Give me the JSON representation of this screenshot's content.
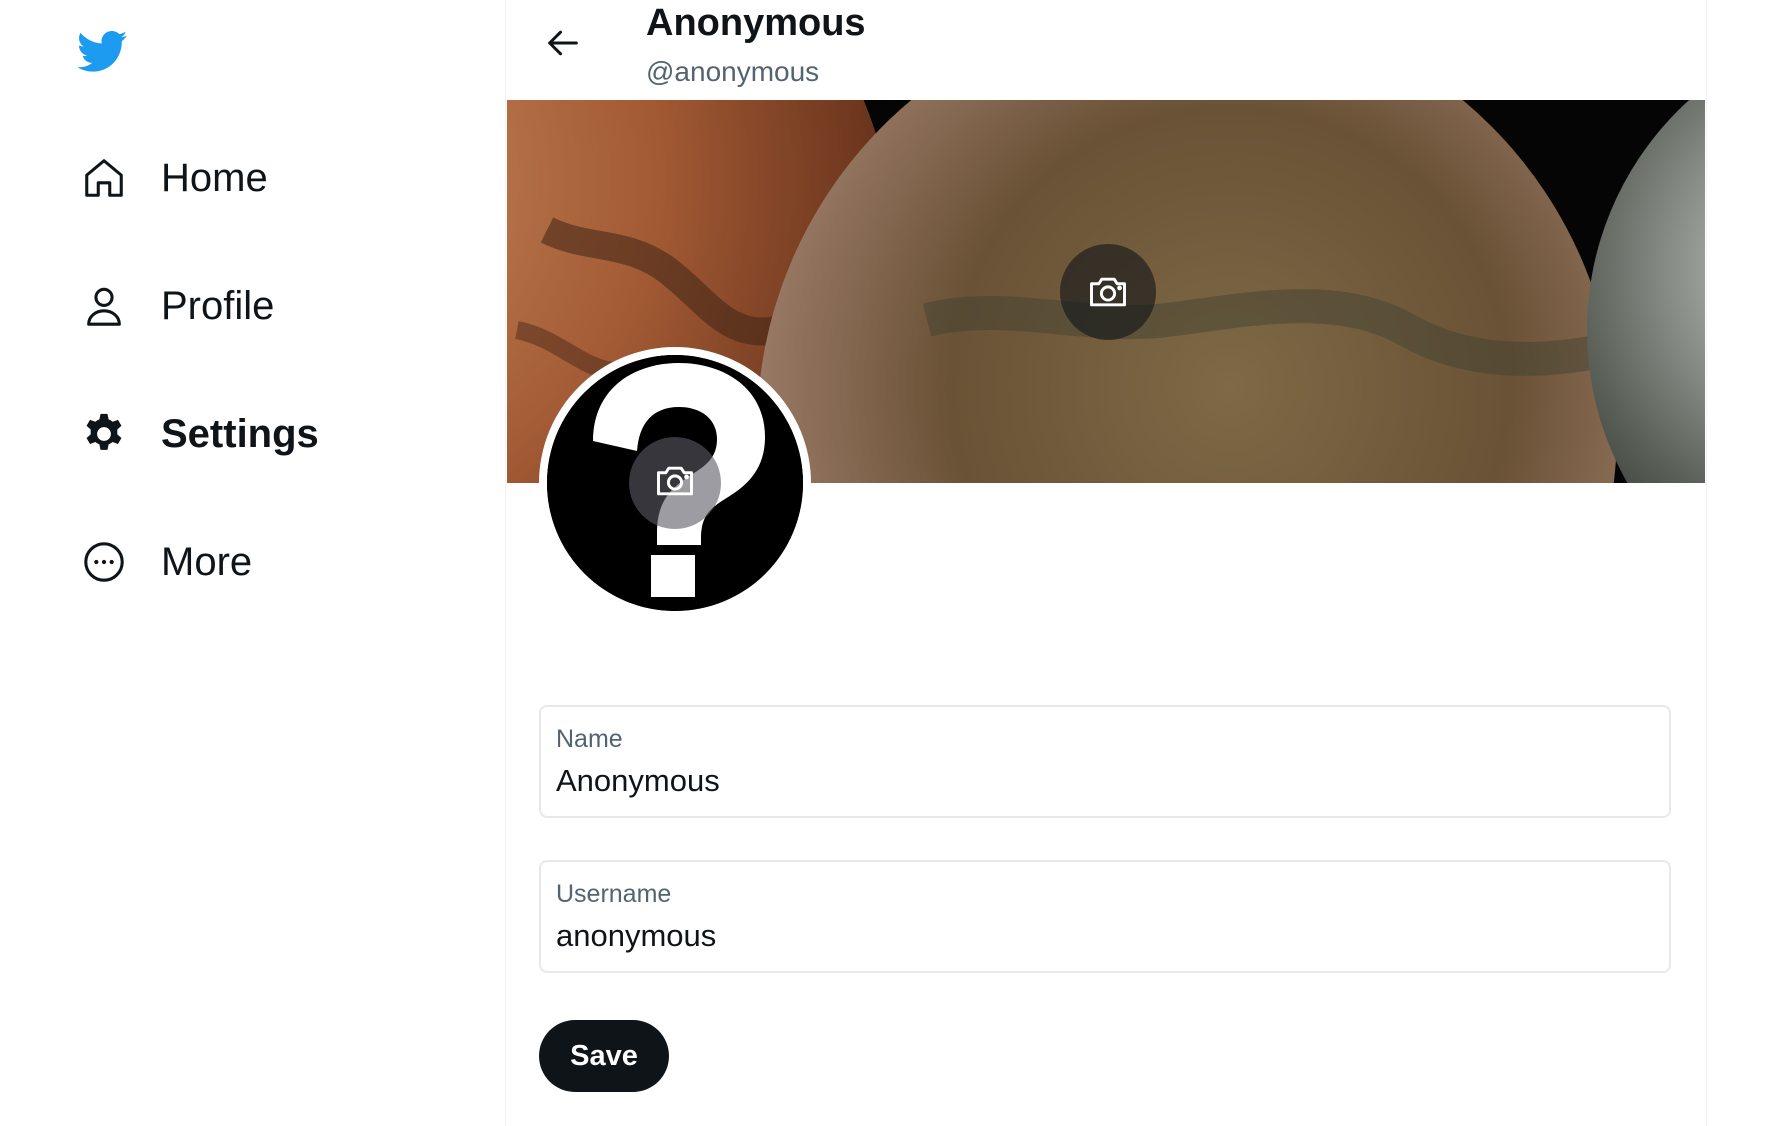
{
  "app": {
    "brand_color": "#1d9bf0",
    "logo_icon": "twitter-bird-icon"
  },
  "sidebar": {
    "items": [
      {
        "label": "Home",
        "icon": "home-icon",
        "active": false
      },
      {
        "label": "Profile",
        "icon": "person-icon",
        "active": false
      },
      {
        "label": "Settings",
        "icon": "gear-icon",
        "active": true
      },
      {
        "label": "More",
        "icon": "more-circle-icon",
        "active": false
      }
    ]
  },
  "header": {
    "title": "Anonymous",
    "handle": "@anonymous",
    "back_icon": "arrow-left-icon"
  },
  "profile": {
    "banner_camera_icon": "camera-icon",
    "avatar_camera_icon": "camera-icon"
  },
  "form": {
    "name_label": "Name",
    "name_value": "Anonymous",
    "username_label": "Username",
    "username_value": "anonymous",
    "save_label": "Save"
  }
}
